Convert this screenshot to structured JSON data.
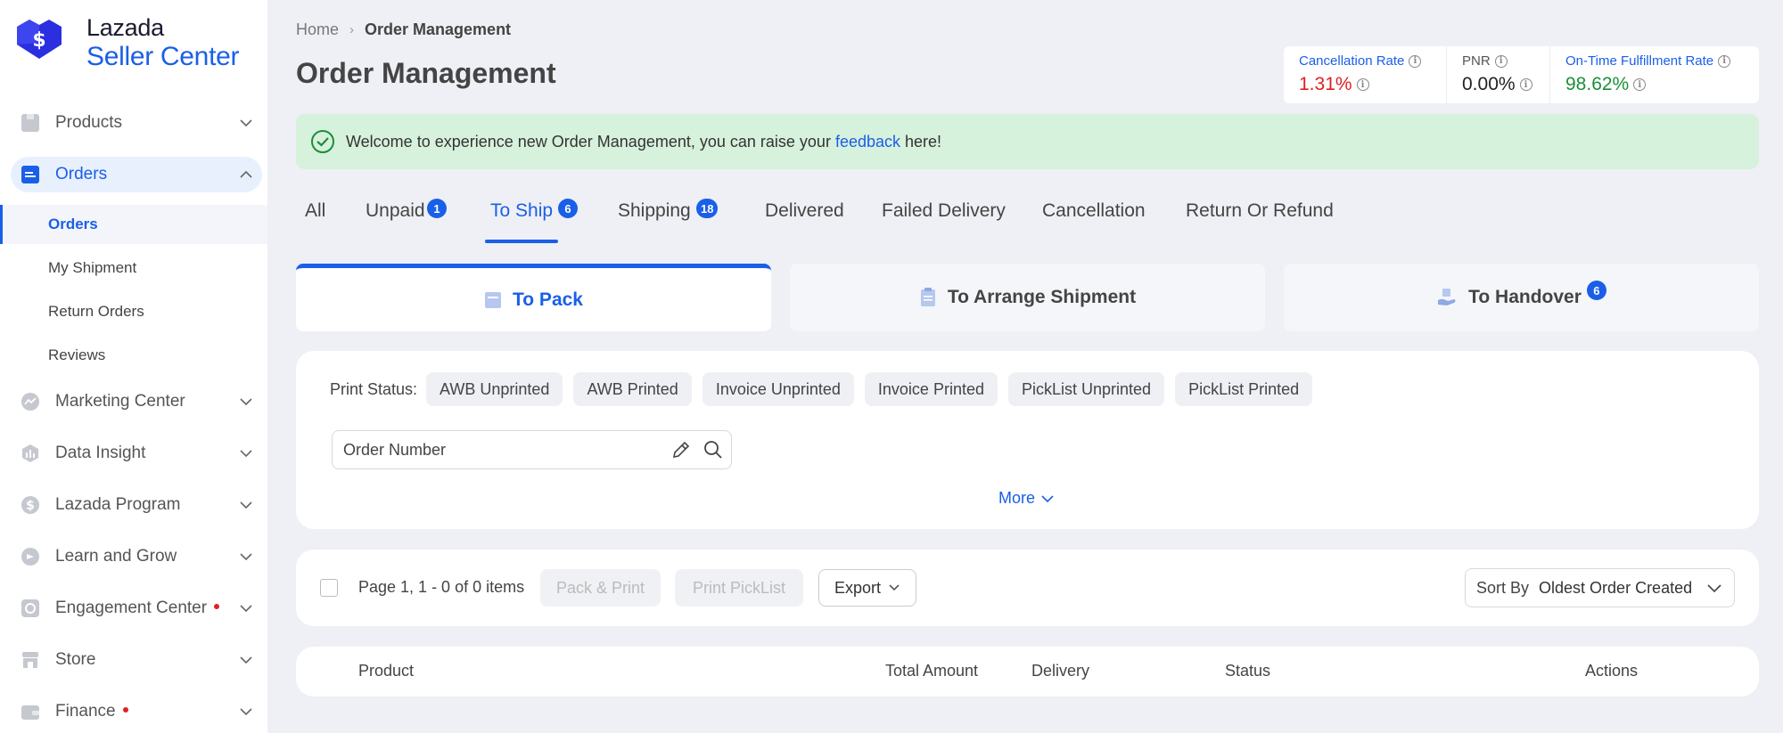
{
  "brand": {
    "line1": "Lazada",
    "line2": "Seller Center"
  },
  "sidebar": {
    "items": [
      {
        "label": "Products",
        "icon": "products-icon"
      },
      {
        "label": "Orders",
        "icon": "orders-icon",
        "active": true
      },
      {
        "label": "Marketing Center",
        "icon": "marketing-icon"
      },
      {
        "label": "Data Insight",
        "icon": "data-insight-icon"
      },
      {
        "label": "Lazada Program",
        "icon": "dollar-icon"
      },
      {
        "label": "Learn and Grow",
        "icon": "learn-icon"
      },
      {
        "label": "Engagement Center",
        "icon": "engagement-icon",
        "dot": true
      },
      {
        "label": "Store",
        "icon": "store-icon"
      },
      {
        "label": "Finance",
        "icon": "wallet-icon",
        "dot": true
      }
    ],
    "order_sub_items": [
      {
        "label": "Orders",
        "active": true
      },
      {
        "label": "My Shipment"
      },
      {
        "label": "Return Orders"
      },
      {
        "label": "Reviews"
      }
    ]
  },
  "breadcrumb": {
    "home": "Home",
    "current": "Order Management"
  },
  "page_title": "Order Management",
  "metrics": [
    {
      "label": "Cancellation Rate",
      "value": "1.31%",
      "color": "#e02020"
    },
    {
      "label": "PNR",
      "value": "0.00%",
      "color": "#222222"
    },
    {
      "label": "On-Time Fulfillment Rate",
      "value": "98.62%",
      "color": "#1b8f3a"
    }
  ],
  "banner": {
    "before": "Welcome to experience new Order Management, you can raise your ",
    "link": "feedback",
    "after": " here!"
  },
  "tabs": [
    {
      "label": "All"
    },
    {
      "label": "Unpaid",
      "badge": "1"
    },
    {
      "label": "To Ship",
      "badge": "6",
      "active": true
    },
    {
      "label": "Shipping",
      "badge": "18"
    },
    {
      "label": "Delivered"
    },
    {
      "label": "Failed Delivery"
    },
    {
      "label": "Cancellation"
    },
    {
      "label": "Return Or Refund"
    }
  ],
  "subtabs": [
    {
      "label": "To Pack",
      "active": true
    },
    {
      "label": "To Arrange Shipment"
    },
    {
      "label": "To Handover",
      "badge": "6"
    }
  ],
  "filters": {
    "print_status_label": "Print Status:",
    "chips": [
      "AWB Unprinted",
      "AWB Printed",
      "Invoice Unprinted",
      "Invoice Printed",
      "PickList Unprinted",
      "PickList Printed"
    ],
    "search_placeholder": "Order Number",
    "more": "More"
  },
  "actions": {
    "page_info": "Page 1, 1 - 0 of 0 items",
    "pack_print": "Pack & Print",
    "print_picklist": "Print PickList",
    "export": "Export",
    "sort_label": "Sort By",
    "sort_value": "Oldest Order Created"
  },
  "table": {
    "columns": [
      "Product",
      "Total Amount",
      "Delivery",
      "Status",
      "Actions"
    ]
  },
  "colors": {
    "accent": "#1a5fe8",
    "banner_bg": "#d6f1dc",
    "page_bg": "#eef0f5"
  }
}
